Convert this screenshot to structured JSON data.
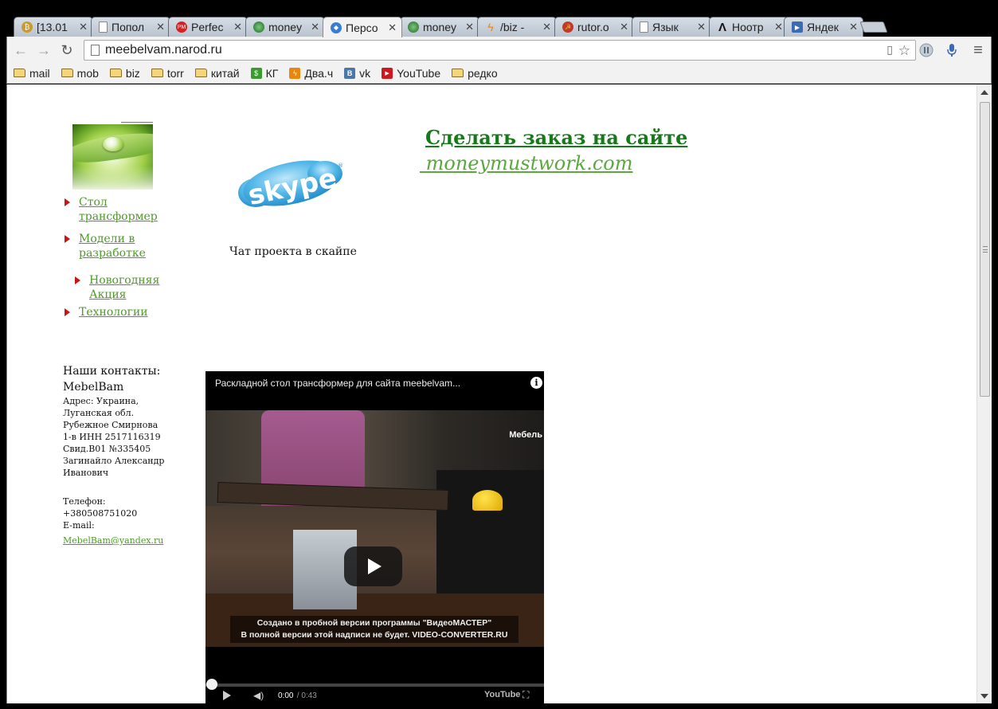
{
  "tabs": [
    {
      "title": "[13.01",
      "icon": "bitcoin-icon",
      "color": "#c99a2e"
    },
    {
      "title": "Попол",
      "icon": "page-icon",
      "color": "#ffffff"
    },
    {
      "title": "Perfec",
      "icon": "perfectmoney-icon",
      "color": "#d42121"
    },
    {
      "title": "money",
      "icon": "leaf-logo-icon",
      "color": "#2f8a32"
    },
    {
      "title": "Персо",
      "icon": "gem-icon",
      "color": "#3a7bd5",
      "active": true
    },
    {
      "title": "money",
      "icon": "leaf-logo-icon",
      "color": "#2f8a32"
    },
    {
      "title": "/biz - ",
      "icon": "lightning-icon",
      "color": "#e8870c"
    },
    {
      "title": "rutor.o",
      "icon": "rutor-icon",
      "color": "#c0392b"
    },
    {
      "title": "Язык ",
      "icon": "page-icon",
      "color": "#ffffff"
    },
    {
      "title": "Ноотр",
      "icon": "lambda-icon",
      "color": "#111111"
    },
    {
      "title": "Яндек",
      "icon": "play-icon",
      "color": "#3b6bb5"
    }
  ],
  "address": {
    "url": "meebelvam.narod.ru"
  },
  "bookmarks": [
    {
      "label": "mail",
      "type": "folder"
    },
    {
      "label": "mob",
      "type": "folder"
    },
    {
      "label": "biz",
      "type": "folder"
    },
    {
      "label": "torr",
      "type": "folder"
    },
    {
      "label": "китай",
      "type": "folder"
    },
    {
      "label": "КГ",
      "type": "link",
      "icon": "kg-icon",
      "color": "#3a9b2f"
    },
    {
      "label": "Два.ч",
      "type": "link",
      "icon": "dvach-icon",
      "color": "#e8870c"
    },
    {
      "label": "vk",
      "type": "link",
      "icon": "vk-icon",
      "color": "#4a76a8"
    },
    {
      "label": "YouTube",
      "type": "link",
      "icon": "youtube-icon",
      "color": "#cc181e"
    },
    {
      "label": "редко",
      "type": "folder"
    }
  ],
  "nav": [
    {
      "label": "Стол трансформер"
    },
    {
      "label": "Модели в разработке"
    },
    {
      "label": "Новогодняя Акция"
    },
    {
      "label": "Технологии"
    }
  ],
  "skype": {
    "logo_text": "skype",
    "caption": "Чат проекта в скайпе"
  },
  "order": {
    "title": "Сделать заказ на сайте",
    "link": " moneymustwork.com"
  },
  "contacts": {
    "heading": "Наши контакты:",
    "company": "MebelBam",
    "address_lines": [
      "Адрес: Украина,",
      "Луганская обл.",
      "Рубежное Смирнова",
      "1-в ИНН 2517116319",
      "Свид.В01 №335405",
      "Загинайло Александр",
      "Иванович"
    ],
    "phone_label": "Телефон:",
    "phone": "+380508751020",
    "email_label": "E-mail:",
    "email": "MebelBam@yandex.ru"
  },
  "video": {
    "title": "Раскладной стол трансформер для сайта meebelvam...",
    "brand": "Мебель",
    "watermark_line1": "Создано в пробной версии программы \"ВидеоМАСТЕР\"",
    "watermark_line2": "В полной версии этой надписи не будет. VIDEO-CONVERTER.RU",
    "time_current": "0:00",
    "time_total": " / 0:43",
    "progress": 0,
    "logo": "YouTube"
  }
}
